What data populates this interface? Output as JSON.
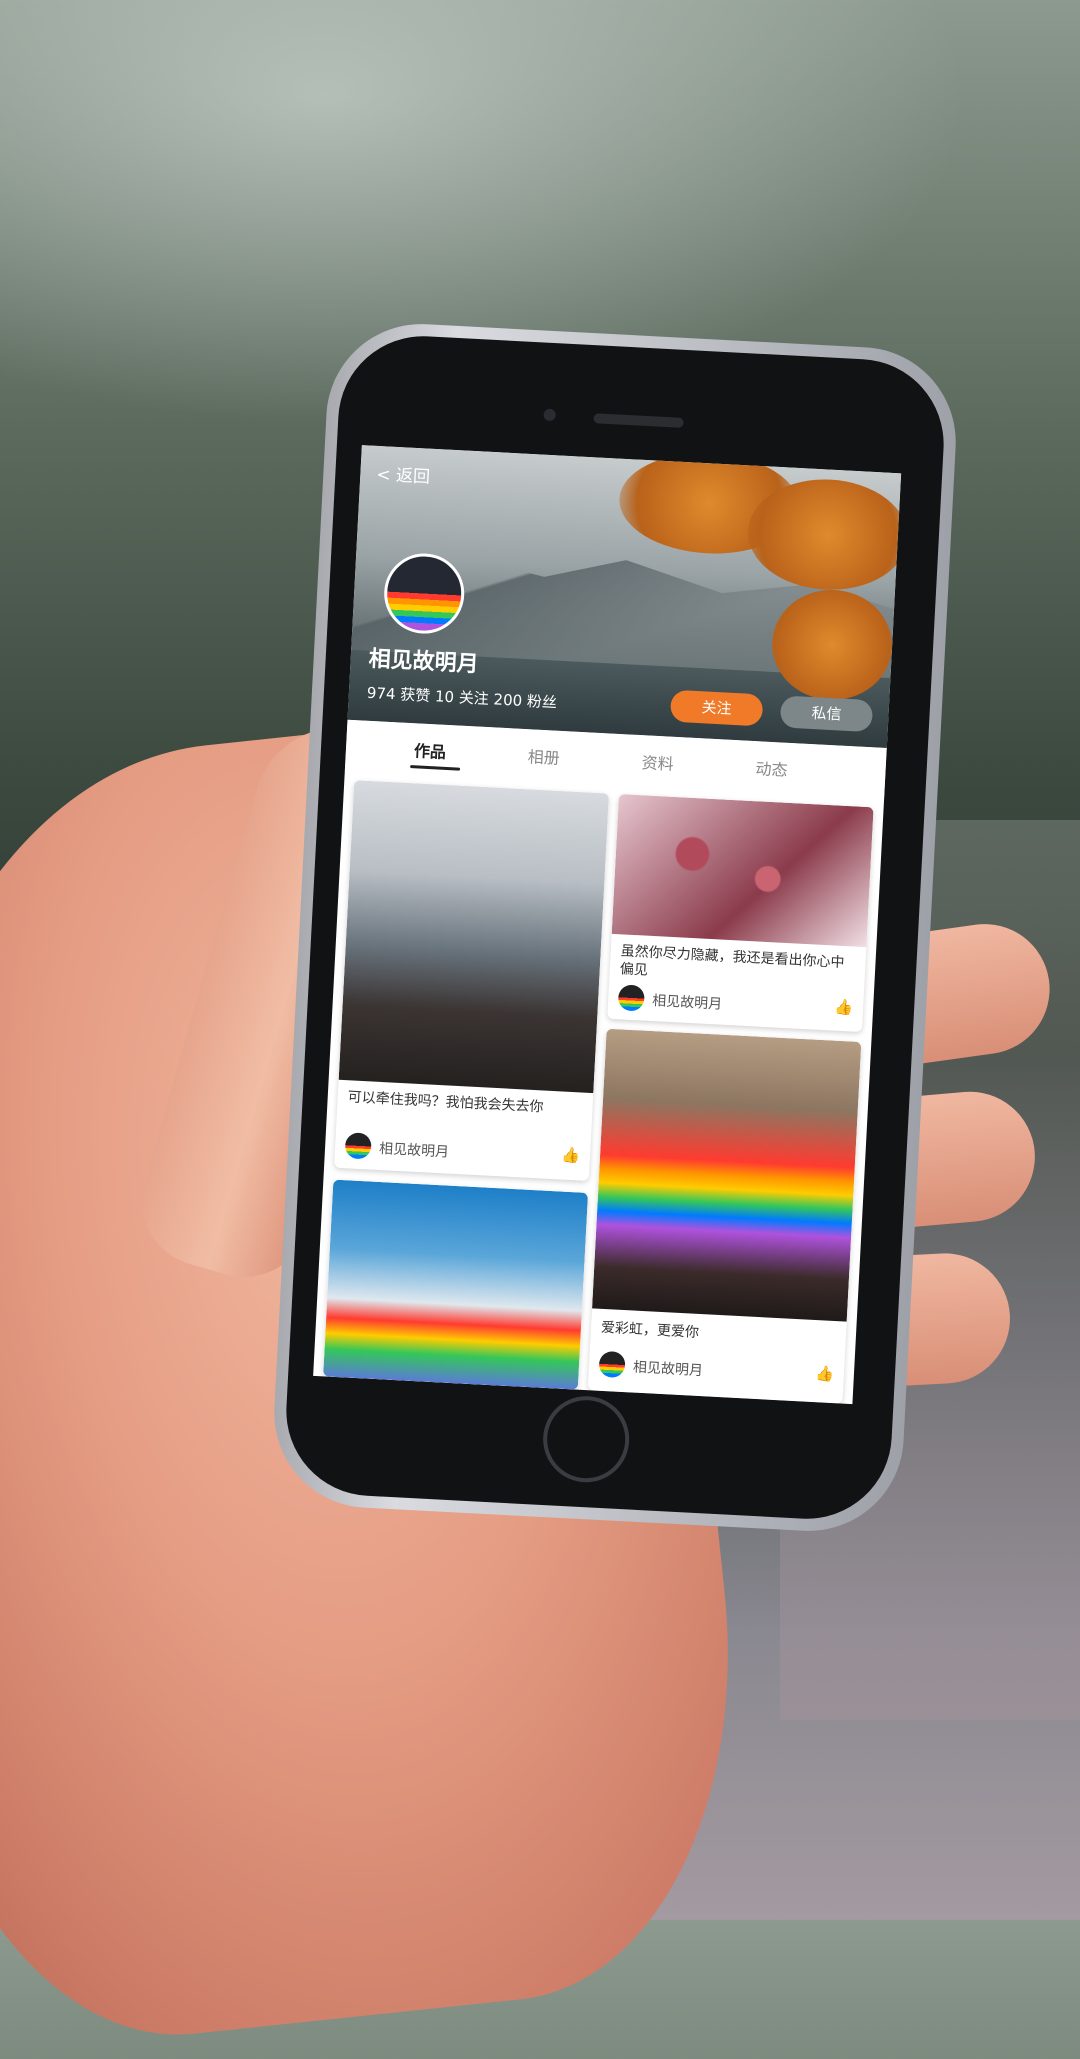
{
  "profile": {
    "back_label": "< 返回",
    "username": "相见故明月",
    "stats": "974 获赞 10 关注 200 粉丝",
    "follow_label": "关注",
    "message_label": "私信"
  },
  "tabs": [
    {
      "label": "作品",
      "active": true
    },
    {
      "label": "相册",
      "active": false
    },
    {
      "label": "资料",
      "active": false
    },
    {
      "label": "动态",
      "active": false
    }
  ],
  "posts": [
    {
      "caption": "可以牵住我吗？我怕我会失去你",
      "author": "相见故明月",
      "liked": true
    },
    {
      "caption": "虽然你尽力隐藏，我还是看出你心中偏见",
      "author": "相见故明月",
      "liked": true
    },
    {
      "caption": "爱彩虹，更爱你",
      "author": "相见故明月",
      "liked": false
    },
    {
      "caption": "",
      "author": "",
      "liked": false
    }
  ],
  "icons": {
    "like_icon": "thumbs-up-icon",
    "back_icon": "chevron-left-icon"
  },
  "colors": {
    "accent": "#f07a28",
    "secondary_button": "#7d8789",
    "like_active": "#e14b36"
  }
}
